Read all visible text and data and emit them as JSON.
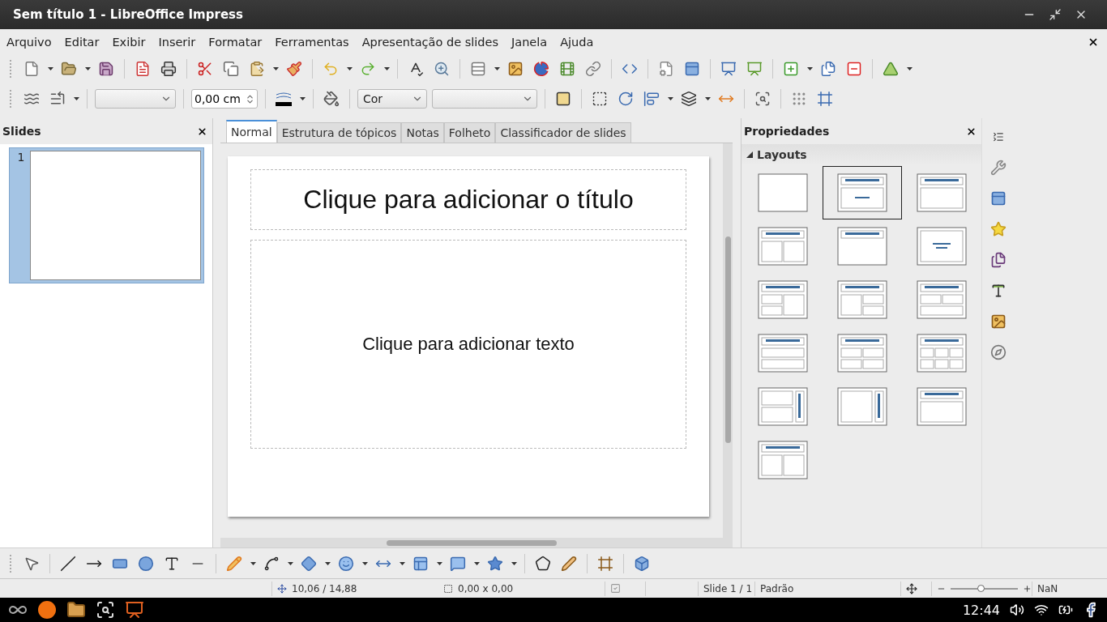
{
  "window": {
    "title": "Sem título 1 - LibreOffice Impress"
  },
  "menu": [
    "Arquivo",
    "Editar",
    "Exibir",
    "Inserir",
    "Formatar",
    "Ferramentas",
    "Apresentação de slides",
    "Janela",
    "Ajuda"
  ],
  "line_toolbar": {
    "line_width": "0,00 cm",
    "fill_type": "Cor"
  },
  "slides_panel": {
    "title": "Slides",
    "slides": [
      {
        "number": "1",
        "selected": true
      }
    ]
  },
  "view_tabs": [
    {
      "label": "Normal",
      "selected": true
    },
    {
      "label": "Estrutura de tópicos",
      "selected": false
    },
    {
      "label": "Notas",
      "selected": false
    },
    {
      "label": "Folheto",
      "selected": false
    },
    {
      "label": "Classificador de slides",
      "selected": false
    }
  ],
  "slide": {
    "title_placeholder": "Clique para adicionar o título",
    "text_placeholder": "Clique para adicionar texto"
  },
  "sidebar": {
    "title": "Propriedades",
    "section": {
      "title": "Layouts",
      "expanded": true
    },
    "layouts": [
      {
        "kind": "blank",
        "selected": false
      },
      {
        "kind": "title-centered",
        "selected": true
      },
      {
        "kind": "title-content",
        "selected": false
      },
      {
        "kind": "title-two-columns",
        "selected": false
      },
      {
        "kind": "title-only",
        "selected": false
      },
      {
        "kind": "centered-text",
        "selected": false
      },
      {
        "kind": "title-left-split",
        "selected": false
      },
      {
        "kind": "title-right-split",
        "selected": false
      },
      {
        "kind": "title-top-split",
        "selected": false
      },
      {
        "kind": "title-two-rows",
        "selected": false
      },
      {
        "kind": "title-four",
        "selected": false
      },
      {
        "kind": "title-six",
        "selected": false
      },
      {
        "kind": "vertical-two-rows",
        "selected": false
      },
      {
        "kind": "vertical-content",
        "selected": false
      },
      {
        "kind": "title-content",
        "selected": false
      },
      {
        "kind": "title-two-columns",
        "selected": false
      }
    ]
  },
  "status_bar": {
    "position": "10,06 / 14,88",
    "size": "0,00 x 0,00",
    "slide": "Slide 1 / 1",
    "master": "Padrão",
    "zoom": {
      "level": 0.44
    },
    "zoom_value": "NaN"
  },
  "taskbar": {
    "clock": "12:44"
  }
}
